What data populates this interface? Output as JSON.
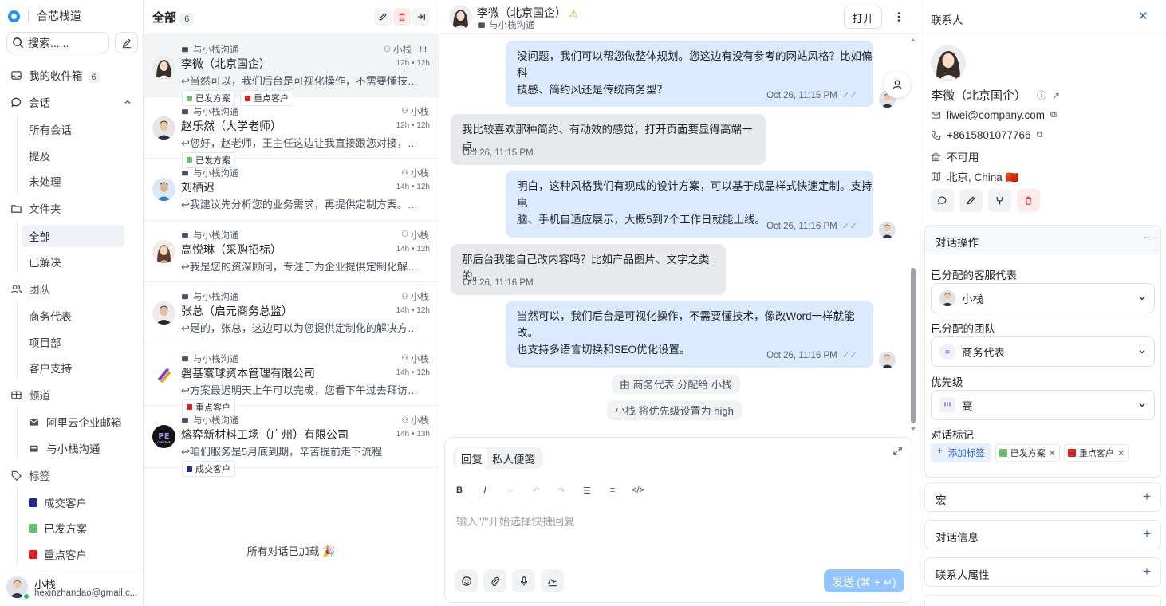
{
  "sidebar": {
    "brand": "合芯栈道",
    "search_placeholder": "搜索......",
    "inbox": {
      "label": "我的收件箱",
      "count": "6"
    },
    "conversations": {
      "label": "会话",
      "items": [
        "所有会话",
        "提及",
        "未处理"
      ]
    },
    "folders": {
      "label": "文件夹",
      "items": [
        "全部",
        "已解决"
      ]
    },
    "teams": {
      "label": "团队",
      "items": [
        "商务代表",
        "项目部",
        "客户支持"
      ]
    },
    "channels": {
      "label": "频道",
      "items": [
        "阿里云企业邮箱",
        "与小栈沟通"
      ]
    },
    "labels": {
      "label": "标签",
      "items": [
        {
          "name": "成交客户",
          "color": "#1e2a8a"
        },
        {
          "name": "已发方案",
          "color": "#6cbf6a"
        },
        {
          "name": "重点客户",
          "color": "#e21d1d"
        }
      ]
    },
    "user": {
      "name": "小栈",
      "email": "hexinzhandao@gmail.c..."
    }
  },
  "list": {
    "title": "全部",
    "count": "6",
    "conversations": [
      {
        "inbox": "与小栈沟通",
        "agent": "小栈",
        "priority": "!!!",
        "name": "李微（北京国企）",
        "time": "12h • 12h",
        "msg": "↩当然可以，我们后台是可视化操作，不需要懂技术...",
        "tags": [
          {
            "name": "已发方案",
            "color": "#6cbf6a"
          },
          {
            "name": "重点客户",
            "color": "#e21d1d"
          }
        ]
      },
      {
        "inbox": "与小栈沟通",
        "agent": "小栈",
        "name": "赵乐然（大学老师）",
        "time": "12h • 12h",
        "msg": "↩您好，赵老师，王主任这边让我直接跟您对接，辛苦",
        "tags": [
          {
            "name": "已发方案",
            "color": "#6cbf6a"
          }
        ]
      },
      {
        "inbox": "与小栈沟通",
        "agent": "小栈",
        "name": "刘栖迟",
        "time": "14h • 12h",
        "msg": "↩我建议先分析您的业务需求，再提供定制方案。如...",
        "tags": []
      },
      {
        "inbox": "与小栈沟通",
        "agent": "小栈",
        "name": "高悦琳（采购招标）",
        "time": "14h • 12h",
        "msg": "↩我是您的资深顾问，专注于为企业提供定制化解决...",
        "tags": []
      },
      {
        "inbox": "与小栈沟通",
        "agent": "小栈",
        "name": "张总（启元商务总监）",
        "time": "14h • 12h",
        "msg": "↩是的，张总，这边可以为您提供定制化的解决方案...",
        "tags": []
      },
      {
        "inbox": "与小栈沟通",
        "agent": "小栈",
        "name": "磐基寰球资本管理有限公司",
        "time": "14h • 12h",
        "msg": "↩方案最迟明天上午可以完成，您看下午过去拜访，...",
        "tags": [
          {
            "name": "重点客户",
            "color": "#e21d1d"
          }
        ]
      },
      {
        "inbox": "与小栈沟通",
        "agent": "小栈",
        "name": "熔弈新材料工场（广州）有限公司",
        "time": "14h • 13h",
        "msg": "↩咱们服务是5月底到期，辛苦提前走下流程",
        "tags": [
          {
            "name": "成交客户",
            "color": "#1e2a8a"
          }
        ]
      }
    ],
    "loaded": "所有对话已加载 🎉"
  },
  "chat": {
    "name": "李微（北京国企）",
    "inbox": "与小栈沟通",
    "open_label": "打开",
    "messages": [
      {
        "dir": "out",
        "lines": [
          "没问题，我们可以帮您做整体规划。您这边有没有参考的网站风格？比如偏科",
          "技感、简约风还是传统商务型？"
        ],
        "time": "Oct 26, 11:15 PM"
      },
      {
        "dir": "in",
        "lines": [
          "我比较喜欢那种简约、有动效的感觉，打开页面要显得高端一点。"
        ],
        "time": "Oct 26, 11:15 PM"
      },
      {
        "dir": "out",
        "lines": [
          "明白，这种风格我们有现成的设计方案，可以基于成品样式快速定制。支持电",
          "脑、手机自适应展示，大概5到7个工作日就能上线。"
        ],
        "time": "Oct 26, 11:16 PM"
      },
      {
        "dir": "in",
        "lines": [
          "那后台我能自己改内容吗？比如产品图片、文字之类的。"
        ],
        "time": "Oct 26, 11:16 PM"
      },
      {
        "dir": "out",
        "lines": [
          "当然可以，我们后台是可视化操作，不需要懂技术，像改Word一样就能改。",
          "也支持多语言切换和SEO优化设置。"
        ],
        "time": "Oct 26, 11:16 PM"
      }
    ],
    "activities": [
      "由 商务代表 分配给 小栈",
      "小栈 将优先级设置为 high"
    ],
    "composer": {
      "tab_reply": "回复",
      "tab_note": "私人便笺",
      "placeholder": "输入\"/\"开始选择快捷回复",
      "send_label": "发送 (⌘ + ↵)",
      "format": [
        "B",
        "I",
        "⇔",
        "↶",
        "↷",
        "☰",
        "≡",
        "</>"
      ]
    }
  },
  "contact": {
    "title": "联系人",
    "name": "李微（北京国企）",
    "email": "liwei@company.com",
    "phone": "+8615801077766",
    "company": "不可用",
    "location": "北京, China 🇨🇳",
    "actions_panel": {
      "title": "对话操作",
      "agent_label": "已分配的客服代表",
      "agent_value": "小栈",
      "team_label": "已分配的团队",
      "team_value": "商务代表",
      "priority_label": "优先级",
      "priority_value": "高",
      "priority_icon": "!!!",
      "labels_label": "对话标记",
      "add_label": "添加标签",
      "labels": [
        {
          "name": "已发方案",
          "color": "#6cbf6a"
        },
        {
          "name": "重点客户",
          "color": "#e21d1d"
        }
      ]
    },
    "macros": "宏",
    "conv_info": "对话信息",
    "contact_attrs": "联系人属性"
  }
}
